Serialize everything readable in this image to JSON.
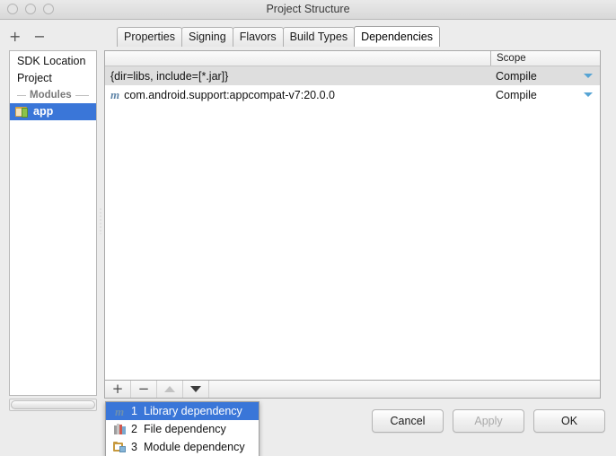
{
  "window": {
    "title": "Project Structure",
    "traffic_lights": [
      "close-button",
      "minimize-button",
      "zoom-button"
    ]
  },
  "sidebar": {
    "toolbar": {
      "add_label": "+",
      "remove_label": "−"
    },
    "items": [
      {
        "label": "SDK Location",
        "type": "item",
        "selected": false
      },
      {
        "label": "Project",
        "type": "item",
        "selected": false
      },
      {
        "label": "Modules",
        "type": "separator"
      },
      {
        "label": "app",
        "type": "module",
        "selected": true,
        "icon": "module-icon"
      }
    ]
  },
  "tabs": [
    {
      "label": "Properties",
      "active": false
    },
    {
      "label": "Signing",
      "active": false
    },
    {
      "label": "Flavors",
      "active": false
    },
    {
      "label": "Build Types",
      "active": false
    },
    {
      "label": "Dependencies",
      "active": true
    }
  ],
  "table": {
    "columns": [
      "",
      "Scope"
    ],
    "rows": [
      {
        "icon": "",
        "name": "{dir=libs, include=[*.jar]}",
        "scope": "Compile"
      },
      {
        "icon": "maven-m-icon",
        "name": "com.android.support:appcompat-v7:20.0.0",
        "scope": "Compile"
      }
    ]
  },
  "table_toolbar": {
    "buttons": [
      {
        "name": "add-dependency-button",
        "glyph": "+",
        "enabled": true
      },
      {
        "name": "remove-dependency-button",
        "glyph": "−",
        "enabled": true
      },
      {
        "name": "move-up-button",
        "glyph": "▲",
        "enabled": false
      },
      {
        "name": "move-down-button",
        "glyph": "▼",
        "enabled": true
      }
    ]
  },
  "popup_menu": {
    "items": [
      {
        "num": "1",
        "label": "Library dependency",
        "icon": "maven-m-icon",
        "selected": true
      },
      {
        "num": "2",
        "label": "File dependency",
        "icon": "books-icon",
        "selected": false
      },
      {
        "num": "3",
        "label": "Module dependency",
        "icon": "folder-module-icon",
        "selected": false
      }
    ]
  },
  "dialog_buttons": [
    {
      "label": "Cancel",
      "enabled": true
    },
    {
      "label": "Apply",
      "enabled": false
    },
    {
      "label": "OK",
      "enabled": true
    }
  ],
  "colors": {
    "selection": "#3a76d8",
    "window_bg": "#ececec",
    "row_alt": "#dedede",
    "caret": "#57a4d4"
  }
}
